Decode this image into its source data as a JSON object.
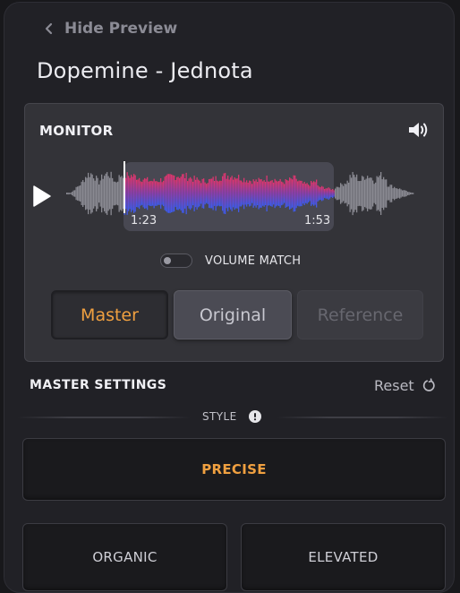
{
  "nav": {
    "hide_preview": "Hide Preview"
  },
  "track": {
    "title": "Dopemine - Jednota"
  },
  "monitor": {
    "title": "MONITOR",
    "selection_start": "1:23",
    "selection_end": "1:53",
    "volume_match_label": "VOLUME MATCH",
    "volume_match_on": false,
    "modes": [
      {
        "label": "Master",
        "state": "active"
      },
      {
        "label": "Original",
        "state": "normal"
      },
      {
        "label": "Reference",
        "state": "disabled"
      }
    ]
  },
  "settings": {
    "title": "MASTER SETTINGS",
    "reset_label": "Reset",
    "style_label": "STYLE",
    "styles": [
      {
        "label": "PRECISE",
        "selected": true
      },
      {
        "label": "ORGANIC",
        "selected": false
      },
      {
        "label": "ELEVATED",
        "selected": false
      }
    ]
  },
  "colors": {
    "accent": "#f0a040",
    "wave_top": "#e2356a",
    "wave_bottom": "#3b5bf0",
    "wave_inactive": "#8a8a92"
  },
  "icons": {
    "back": "chevron-left-icon",
    "volume": "speaker-volume-icon",
    "play": "play-icon",
    "reset": "reset-icon",
    "info": "info-icon"
  }
}
